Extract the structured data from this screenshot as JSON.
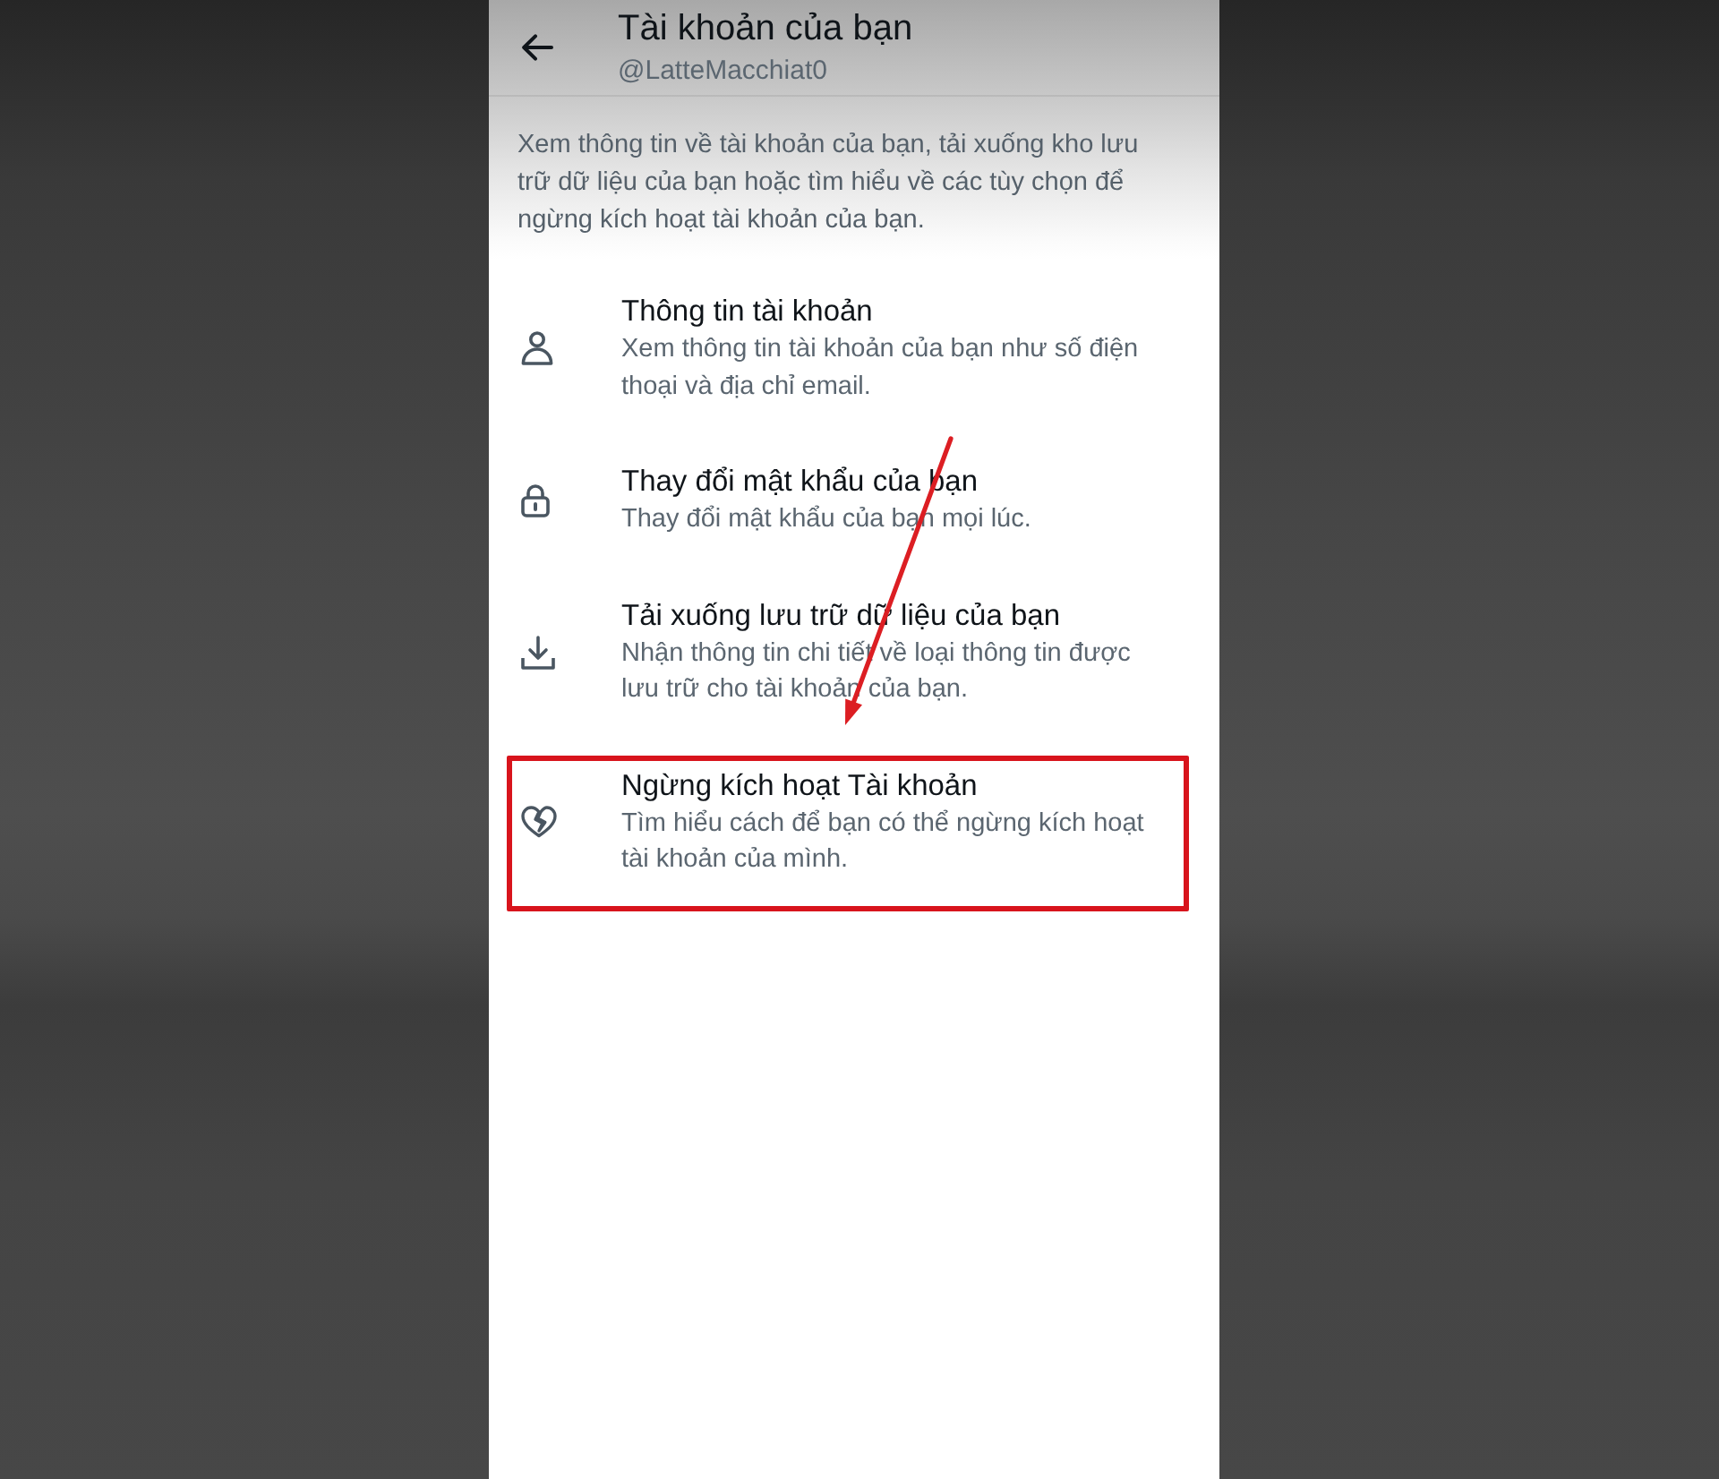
{
  "header": {
    "title": "Tài khoản của bạn",
    "handle": "@LatteMacchiat0"
  },
  "description": "Xem thông tin về tài khoản của bạn, tải xuống kho lưu trữ dữ liệu của bạn hoặc tìm hiểu về các tùy chọn để ngừng kích hoạt tài khoản của bạn.",
  "items": [
    {
      "kind": "profile",
      "title": "Thông tin tài khoản",
      "subtitle": "Xem thông tin tài khoản của bạn như số điện thoại và địa chỉ email.",
      "highlighted": false
    },
    {
      "kind": "password",
      "title": "Thay đổi mật khẩu của bạn",
      "subtitle": "Thay đổi mật khẩu của bạn mọi lúc.",
      "highlighted": false
    },
    {
      "kind": "download",
      "title": "Tải xuống lưu trữ dữ liệu của bạn",
      "subtitle": "Nhận thông tin chi tiết về loại thông tin được lưu trữ cho tài khoản của bạn.",
      "highlighted": false
    },
    {
      "kind": "deactivate",
      "title": "Ngừng kích hoạt Tài khoản",
      "subtitle": "Tìm hiểu cách để bạn có thể ngừng kích hoạt tài khoản của mình.",
      "highlighted": true
    }
  ]
}
